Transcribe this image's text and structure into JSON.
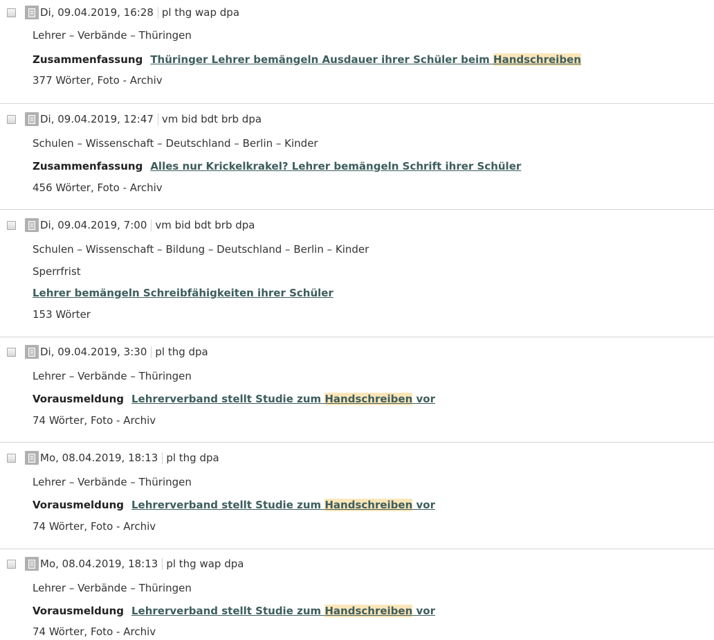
{
  "entries": [
    {
      "date": "Di, 09.04.2019, 16:28",
      "source": "pl thg wap dpa",
      "tags": "Lehrer – Verbände – Thüringen",
      "category": "Zusammenfassung",
      "note": "",
      "title_before": "Thüringer Lehrer bemängeln Ausdauer ihrer Schüler beim ",
      "title_highlight": "Handschreiben",
      "title_after": "",
      "meta": "377 Wörter, Foto - Archiv"
    },
    {
      "date": "Di, 09.04.2019, 12:47",
      "source": "vm bid bdt brb dpa",
      "tags": "Schulen – Wissenschaft – Deutschland – Berlin – Kinder",
      "category": "Zusammenfassung",
      "note": "",
      "title_before": "Alles nur Krickelkrakel? Lehrer bemängeln Schrift ihrer Schüler",
      "title_highlight": "",
      "title_after": "",
      "meta": "456 Wörter, Foto - Archiv"
    },
    {
      "date": "Di, 09.04.2019, 7:00",
      "source": "vm bid bdt brb dpa",
      "tags": "Schulen – Wissenschaft – Bildung – Deutschland – Berlin – Kinder",
      "category": "",
      "note": "Sperrfrist",
      "title_before": "Lehrer bemängeln Schreibfähigkeiten ihrer Schüler",
      "title_highlight": "",
      "title_after": "",
      "meta": "153 Wörter"
    },
    {
      "date": "Di, 09.04.2019, 3:30",
      "source": "pl thg dpa",
      "tags": "Lehrer – Verbände – Thüringen",
      "category": "Vorausmeldung",
      "note": "",
      "title_before": "Lehrerverband stellt Studie zum ",
      "title_highlight": "Handschreiben",
      "title_after": " vor",
      "meta": "74 Wörter, Foto - Archiv"
    },
    {
      "date": "Mo, 08.04.2019, 18:13",
      "source": "pl thg dpa",
      "tags": "Lehrer – Verbände – Thüringen",
      "category": "Vorausmeldung",
      "note": "",
      "title_before": "Lehrerverband stellt Studie zum ",
      "title_highlight": "Handschreiben",
      "title_after": " vor",
      "meta": "74 Wörter, Foto - Archiv"
    },
    {
      "date": "Mo, 08.04.2019, 18:13",
      "source": "pl thg wap dpa",
      "tags": "Lehrer – Verbände – Thüringen",
      "category": "Vorausmeldung",
      "note": "",
      "title_before": "Lehrerverband stellt Studie zum ",
      "title_highlight": "Handschreiben",
      "title_after": " vor",
      "meta": "74 Wörter, Foto - Archiv"
    }
  ],
  "colors": {
    "link": "#3d5d5d",
    "highlight": "#fbe6b8",
    "divider": "#d4d4d4"
  },
  "icons": [
    "checkbox-icon",
    "document-icon"
  ]
}
